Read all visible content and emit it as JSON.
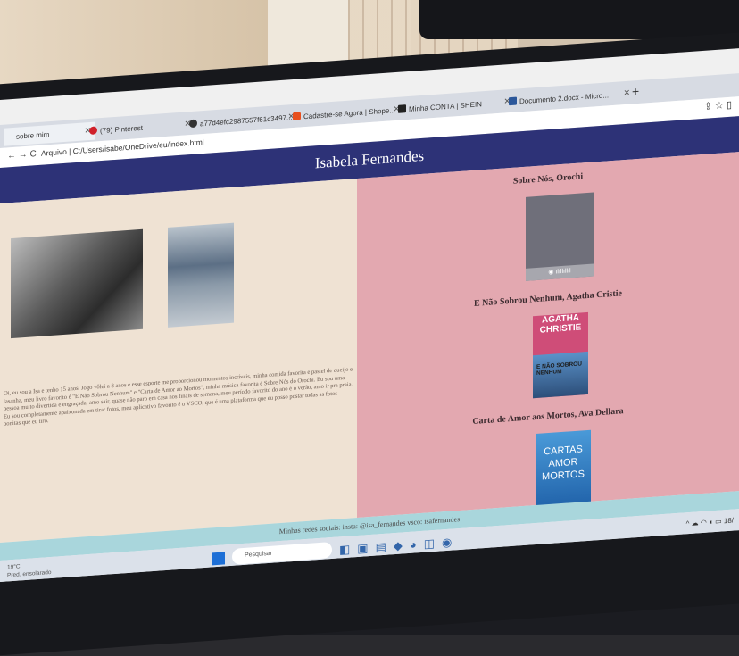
{
  "browser": {
    "tabs": [
      {
        "label": "sobre mim"
      },
      {
        "label": "(79) Pinterest"
      },
      {
        "label": "a77d4efc2987557f61c3497..."
      },
      {
        "label": "Cadastre-se Agora | Shope..."
      },
      {
        "label": "Minha CONTA | SHEIN"
      },
      {
        "label": "Documento 2.docx - Micro..."
      }
    ],
    "new_tab": "+",
    "address": "Arquivo  |  C:/Users/isabe/OneDrive/eu/index.html",
    "nav": "←  →  C"
  },
  "page": {
    "title": "Isabela Fernandes",
    "bio": "Oi, eu sou a Isa e tenho 15 anos. Jogo vôlei a 8 anos e esse esporte me proporcionou momentos incríveis, minha comida favorita é pastel de queijo e lasanha, meu livro favorito é \"E Não Sobrou Nenhum\" e \"Carta de Amor ao Mortos\", minha música favorita é Sobre Nós do Orochi. Eu sou uma pessoa muito divertida e engraçada, amo sair, quase não paro em casa nos finais de semana, meu período favorito do ano é o verão, amo ir pra praia. Eu sou completamente apaixonada em tirar fotos, meu aplicativo favorito é o VSCO, que é uma plataforma que eu posso postar todas as fotos bonitas que eu tiro.",
    "favorites": [
      {
        "title": "Sobre Nós, Orochi"
      },
      {
        "title": "E Não Sobrou Nenhum, Agatha Cristie",
        "cover_top": "AGATHA CHRISTIE",
        "cover_bottom": "E NÃO SOBROU NENHUM"
      },
      {
        "title": "Carta de Amor aos Mortos, Ava Dellara",
        "cover_text": "CARTAS AMOR MORTOS"
      }
    ],
    "footer": "Minhas redes sociais: insta: @isa_fernandes vsco: isafernandes"
  },
  "taskbar": {
    "weather": "19°C",
    "weather_sub": "Pred. ensolarado",
    "search": "Pesquisar",
    "time": "18/"
  }
}
